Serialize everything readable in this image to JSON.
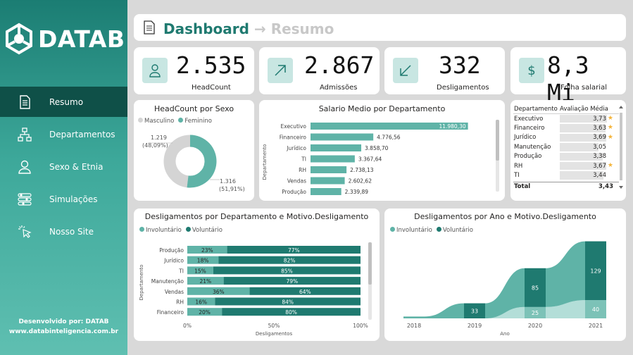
{
  "brand": {
    "logo_text": "DATAB",
    "credits_line1": "Desenvolvido por: DATAB",
    "credits_line2": "www.databinteligencia.com.br"
  },
  "nav": [
    {
      "label": "Resumo",
      "icon": "document-icon",
      "active": true
    },
    {
      "label": "Departamentos",
      "icon": "org-chart-icon",
      "active": false
    },
    {
      "label": "Sexo & Etnia",
      "icon": "person-icon",
      "active": false
    },
    {
      "label": "Simulações",
      "icon": "sliders-icon",
      "active": false
    },
    {
      "label": "Nosso Site",
      "icon": "cursor-click-icon",
      "active": false
    }
  ],
  "header": {
    "title": "Dashboard",
    "arrow": "→",
    "subtitle": "Resumo"
  },
  "kpis": [
    {
      "value": "2.535",
      "label": "HeadCount",
      "icon": "person-icon"
    },
    {
      "value": "2.867",
      "label": "Admissões",
      "icon": "arrow-up-right-icon"
    },
    {
      "value": "332",
      "label": "Desligamentos",
      "icon": "arrow-down-left-icon"
    },
    {
      "value": "8,3 Mi",
      "label": "Folha salarial",
      "icon": "dollar-icon"
    }
  ],
  "colors": {
    "primary": "#1f7a70",
    "secondary": "#5fb3a7",
    "light": "#b3ded8",
    "grey": "#d4d4d4",
    "sidebar_active": "#0f5048"
  },
  "chart_data": [
    {
      "type": "pie",
      "title": "HeadCount por Sexo",
      "legend": [
        "Masculino",
        "Feminino"
      ],
      "slices": [
        {
          "name": "Masculino",
          "value": 1219,
          "label": "1.219",
          "pct": "(48,09%)"
        },
        {
          "name": "Feminino",
          "value": 1316,
          "label": "1.316",
          "pct": "(51,91%)"
        }
      ]
    },
    {
      "type": "bar",
      "title": "Salario Medio por Departamento",
      "ylabel": "Departamento",
      "categories": [
        "Executivo",
        "Financeiro",
        "Jurídico",
        "TI",
        "RH",
        "Vendas",
        "Produção"
      ],
      "values": [
        11980.3,
        4776.56,
        3858.7,
        3367.64,
        2738.13,
        2602.62,
        2339.89
      ],
      "labels": [
        "11.980,30",
        "4.776,56",
        "3.858,70",
        "3.367,64",
        "2.738,13",
        "2.602,62",
        "2.339,89"
      ]
    },
    {
      "type": "table",
      "columns": [
        "Departamento",
        "Avaliação Média"
      ],
      "rows": [
        {
          "dept": "Executivo",
          "score": 3.73,
          "label": "3,73",
          "star": true
        },
        {
          "dept": "Financeiro",
          "score": 3.63,
          "label": "3,63",
          "star": true
        },
        {
          "dept": "Jurídico",
          "score": 3.69,
          "label": "3,69",
          "star": true
        },
        {
          "dept": "Manutenção",
          "score": 3.05,
          "label": "3,05",
          "star": false
        },
        {
          "dept": "Produção",
          "score": 3.38,
          "label": "3,38",
          "star": false
        },
        {
          "dept": "RH",
          "score": 3.67,
          "label": "3,67",
          "star": true
        },
        {
          "dept": "TI",
          "score": 3.44,
          "label": "3,44",
          "star": false
        }
      ],
      "total_label": "Total",
      "total_value": "3,43"
    },
    {
      "type": "bar",
      "title": "Desligamentos por Departamento e Motivo.Desligamento",
      "xlabel": "Desligamentos",
      "ylabel": "Departamento",
      "legend": [
        "Involuntário",
        "Voluntário"
      ],
      "categories": [
        "Produção",
        "Jurídico",
        "TI",
        "Manutenção",
        "Vendas",
        "RH",
        "Financeiro"
      ],
      "series": [
        {
          "name": "Involuntário",
          "values": [
            23,
            18,
            15,
            21,
            36,
            16,
            20
          ]
        },
        {
          "name": "Voluntário",
          "values": [
            77,
            82,
            85,
            79,
            64,
            84,
            80
          ]
        }
      ],
      "xticks": [
        "0%",
        "50%",
        "100%"
      ]
    },
    {
      "type": "area",
      "title": "Desligamentos por Ano e Motivo.Desligamento",
      "xlabel": "Ano",
      "legend": [
        "Involuntário",
        "Voluntário"
      ],
      "x": [
        "2018",
        "2019",
        "2020",
        "2021"
      ],
      "series": [
        {
          "name": "Involuntário",
          "values": [
            0,
            0,
            25,
            40
          ],
          "labels": [
            "",
            "",
            "25",
            "40"
          ]
        },
        {
          "name": "Voluntário",
          "values": [
            4,
            33,
            85,
            129
          ],
          "labels": [
            "",
            "33",
            "85",
            "129"
          ]
        }
      ]
    }
  ]
}
